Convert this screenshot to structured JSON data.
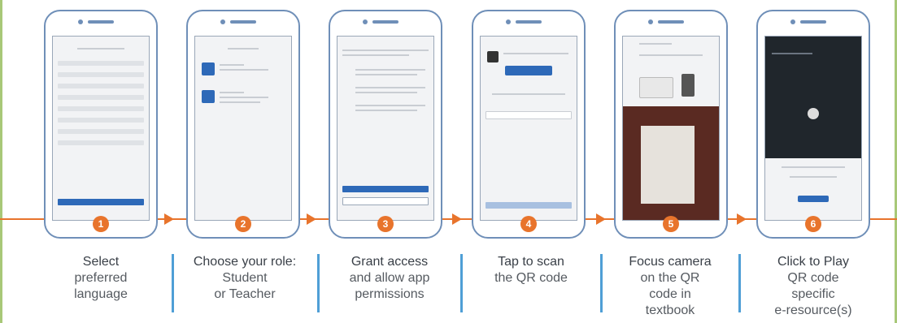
{
  "steps": [
    {
      "number": "1",
      "line1": "Select",
      "line2": "preferred",
      "line3": "language",
      "line4": ""
    },
    {
      "number": "2",
      "line1": "Choose your role:",
      "line2": "Student",
      "line3": "or Teacher",
      "line4": ""
    },
    {
      "number": "3",
      "line1": "Grant access",
      "line2": "and allow app",
      "line3": "permissions",
      "line4": ""
    },
    {
      "number": "4",
      "line1": "Tap to scan",
      "line2": "the QR code",
      "line3": "",
      "line4": ""
    },
    {
      "number": "5",
      "line1": "Focus camera",
      "line2": "on the QR",
      "line3": "code in",
      "line4": "textbook"
    },
    {
      "number": "6",
      "line1": "Click to Play",
      "line2": "QR code",
      "line3": "specific",
      "line4": "e-resource(s)"
    }
  ],
  "colors": {
    "accent": "#e8742c",
    "phone_outline": "#6f8fb8",
    "separator": "#4f9fd6",
    "app_blue": "#2e69b8"
  }
}
